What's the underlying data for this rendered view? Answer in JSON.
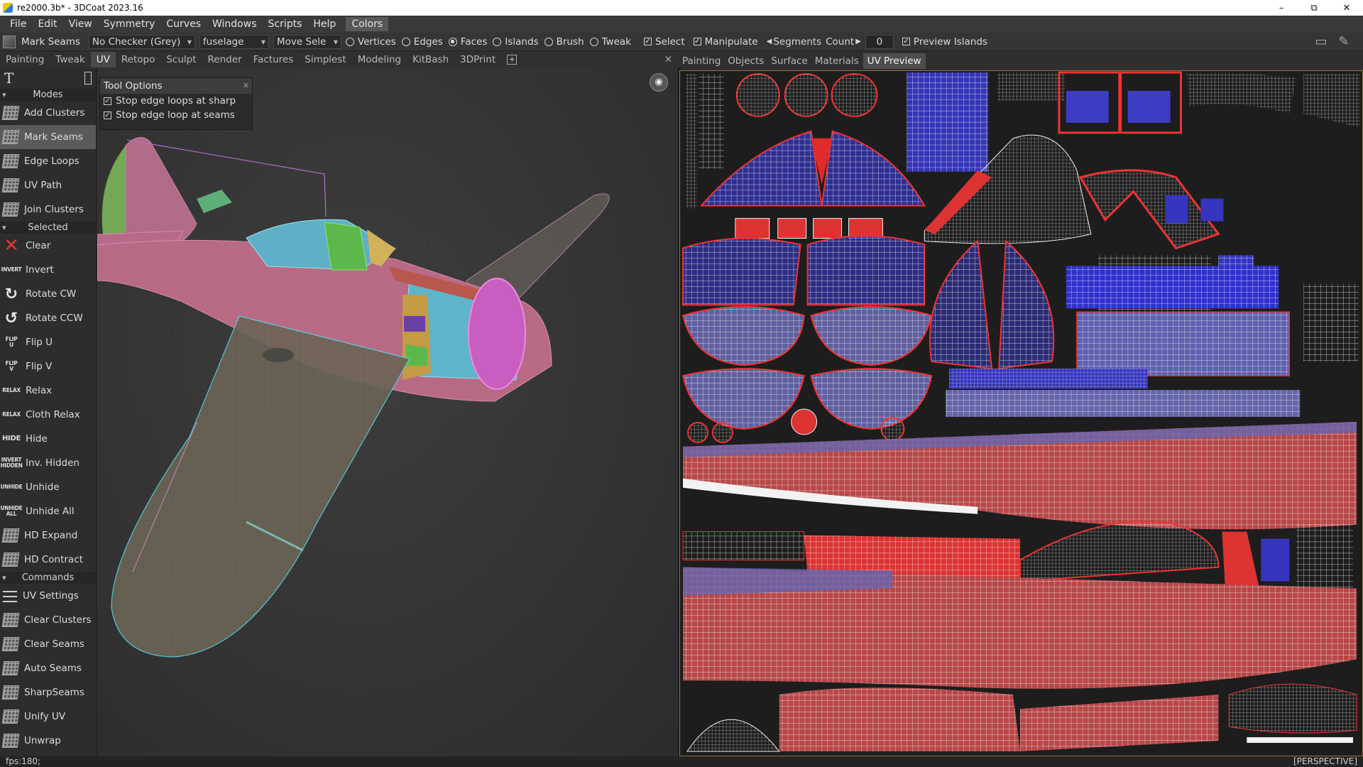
{
  "window": {
    "title": "re2000.3b* - 3DCoat 2023.16",
    "minimize": "–",
    "maximize": "⧉",
    "close": "✕"
  },
  "menu": [
    "File",
    "Edit",
    "View",
    "Symmetry",
    "Curves",
    "Windows",
    "Scripts",
    "Help",
    "Colors"
  ],
  "toolbar": {
    "current_tool": "Mark Seams",
    "checker": "No Checker (Grey)",
    "object": "fuselage",
    "move_select": "Move Sele",
    "radios": [
      {
        "label": "Vertices",
        "on": false
      },
      {
        "label": "Edges",
        "on": false
      },
      {
        "label": "Faces",
        "on": true
      },
      {
        "label": "Islands",
        "on": false
      },
      {
        "label": "Brush",
        "on": false
      },
      {
        "label": "Tweak",
        "on": false
      }
    ],
    "checks": [
      {
        "label": "Select",
        "on": true
      },
      {
        "label": "Manipulate",
        "on": true
      }
    ],
    "segments_label": "Segments",
    "count_label": "Count",
    "count_value": "0",
    "preview_islands": "Preview Islands",
    "check_mark": "✓"
  },
  "rooms": {
    "tabs": [
      "Painting",
      "Tweak",
      "UV",
      "Retopo",
      "Sculpt",
      "Render",
      "Factures",
      "Simplest",
      "Modeling",
      "KitBash",
      "3DPrint"
    ],
    "active": "UV",
    "add": "+",
    "close": "✕"
  },
  "right_tabs": {
    "tabs": [
      "Painting",
      "Objects",
      "Surface",
      "Materials",
      "UV Preview"
    ],
    "active": "UV Preview"
  },
  "left_panel": {
    "text_tool": "T",
    "sections": [
      {
        "title": "Modes",
        "items": [
          {
            "label": "Add Clusters",
            "icon": "grid"
          },
          {
            "label": "Mark Seams",
            "icon": "grid",
            "selected": true
          },
          {
            "label": "Edge Loops",
            "icon": "grid"
          },
          {
            "label": "UV Path",
            "icon": "grid"
          },
          {
            "label": "Join Clusters",
            "icon": "grid"
          }
        ]
      },
      {
        "title": "Selected",
        "items": [
          {
            "label": "Clear",
            "icon": "x"
          },
          {
            "label": "Invert",
            "icon": "INVERT"
          },
          {
            "label": "Rotate CW",
            "icon": "cw"
          },
          {
            "label": "Rotate CCW",
            "icon": "ccw"
          },
          {
            "label": "Flip U",
            "icon": "FLIP U"
          },
          {
            "label": "Flip V",
            "icon": "FLIP V"
          },
          {
            "label": "Relax",
            "icon": "RELAX"
          },
          {
            "label": "Cloth Relax",
            "icon": "RELAX"
          },
          {
            "label": "Hide",
            "icon": "HIDE"
          },
          {
            "label": "Inv. Hidden",
            "icon": "INVERT HIDDEN"
          },
          {
            "label": "Unhide",
            "icon": "UNHIDE"
          },
          {
            "label": "Unhide All",
            "icon": "UNHIDE ALL"
          },
          {
            "label": "HD Expand",
            "icon": "grid"
          },
          {
            "label": "HD Contract",
            "icon": "grid"
          }
        ]
      },
      {
        "title": "Commands",
        "items": [
          {
            "label": "UV Settings",
            "icon": "lines"
          },
          {
            "label": "Clear Clusters",
            "icon": "grid"
          },
          {
            "label": "Clear Seams",
            "icon": "grid"
          },
          {
            "label": "Auto Seams",
            "icon": "grid"
          },
          {
            "label": "SharpSeams",
            "icon": "grid"
          },
          {
            "label": "Unify UV",
            "icon": "grid"
          },
          {
            "label": "Unwrap",
            "icon": "grid"
          }
        ]
      }
    ]
  },
  "tool_options": {
    "title": "Tool Options",
    "close": "✕",
    "options": [
      {
        "label": "Stop edge loops at sharp",
        "checked": true
      },
      {
        "label": "Stop edge loop at seams",
        "checked": true
      }
    ]
  },
  "status": {
    "fps": "fps:180;",
    "projection": "[PERSPECTIVE]"
  },
  "colors": {
    "uv_red": "#d42a2a",
    "uv_blue": "#3a3ad0",
    "seam_white": "#f0f0f0",
    "model_pink": "#c56a8a",
    "model_cyan": "#4fb3c9",
    "model_green": "#5cb84a"
  }
}
